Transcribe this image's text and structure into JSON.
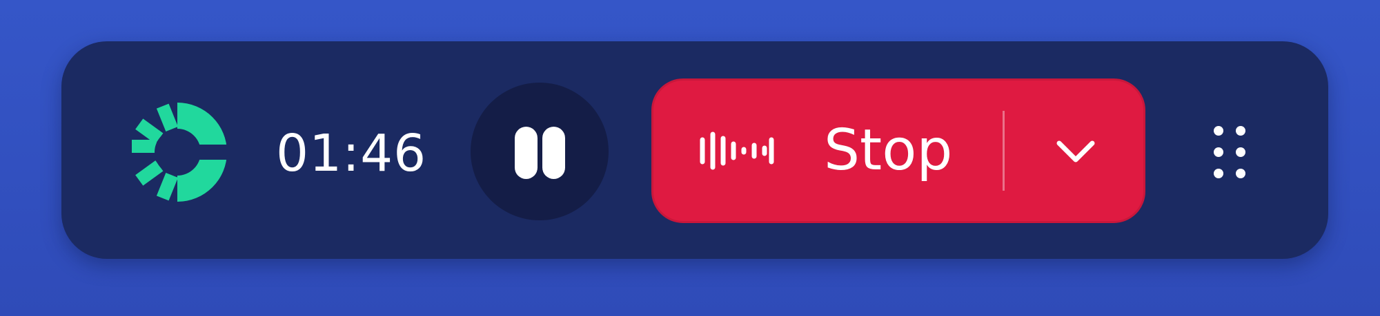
{
  "recorder": {
    "timer": "01:46",
    "stop_label": "Stop"
  },
  "icons": {
    "logo": "brand-logo-icon",
    "pause": "pause-icon",
    "waveform": "audio-waveform-icon",
    "dropdown": "chevron-down-icon",
    "drag": "drag-handle-icon"
  },
  "colors": {
    "background": "#3354c5",
    "bar": "#1b2a62",
    "pause_button": "#141d47",
    "stop_button": "#df1a41",
    "logo": "#21d89d",
    "text": "#ffffff"
  }
}
